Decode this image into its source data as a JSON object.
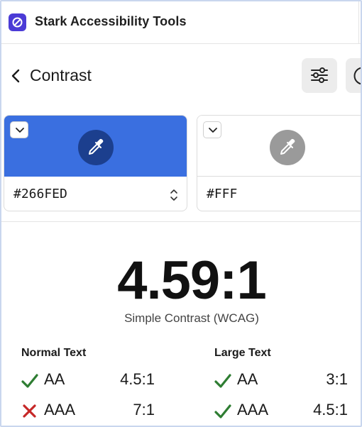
{
  "app": {
    "title": "Stark Accessibility Tools",
    "logo_icon": "stark-logo-icon",
    "brand_color": "#4b3bd6"
  },
  "toolbar": {
    "title": "Contrast",
    "back_icon": "chevron-left-icon",
    "settings_icon": "sliders-icon",
    "help_icon": "help-circle-icon"
  },
  "foreground": {
    "hex": "#266FED",
    "swatch_color": "#3A6FE0",
    "dropper_icon": "eyedropper-icon",
    "menu_icon": "chevron-down-icon"
  },
  "background": {
    "hex": "#FFF",
    "swatch_color": "#FFFFFF",
    "dropper_icon": "eyedropper-icon",
    "menu_icon": "chevron-down-icon"
  },
  "result": {
    "ratio": "4.59:1",
    "algorithm": "Simple Contrast (WCAG)"
  },
  "normal_text": {
    "heading": "Normal Text",
    "rows": [
      {
        "level": "AA",
        "ratio": "4.5:1",
        "pass": true
      },
      {
        "level": "AAA",
        "ratio": "7:1",
        "pass": false
      }
    ]
  },
  "large_text": {
    "heading": "Large Text",
    "rows": [
      {
        "level": "AA",
        "ratio": "3:1",
        "pass": true
      },
      {
        "level": "AAA",
        "ratio": "4.5:1",
        "pass": true
      }
    ]
  },
  "status_colors": {
    "pass": "#2e7d32",
    "fail": "#c62828"
  }
}
